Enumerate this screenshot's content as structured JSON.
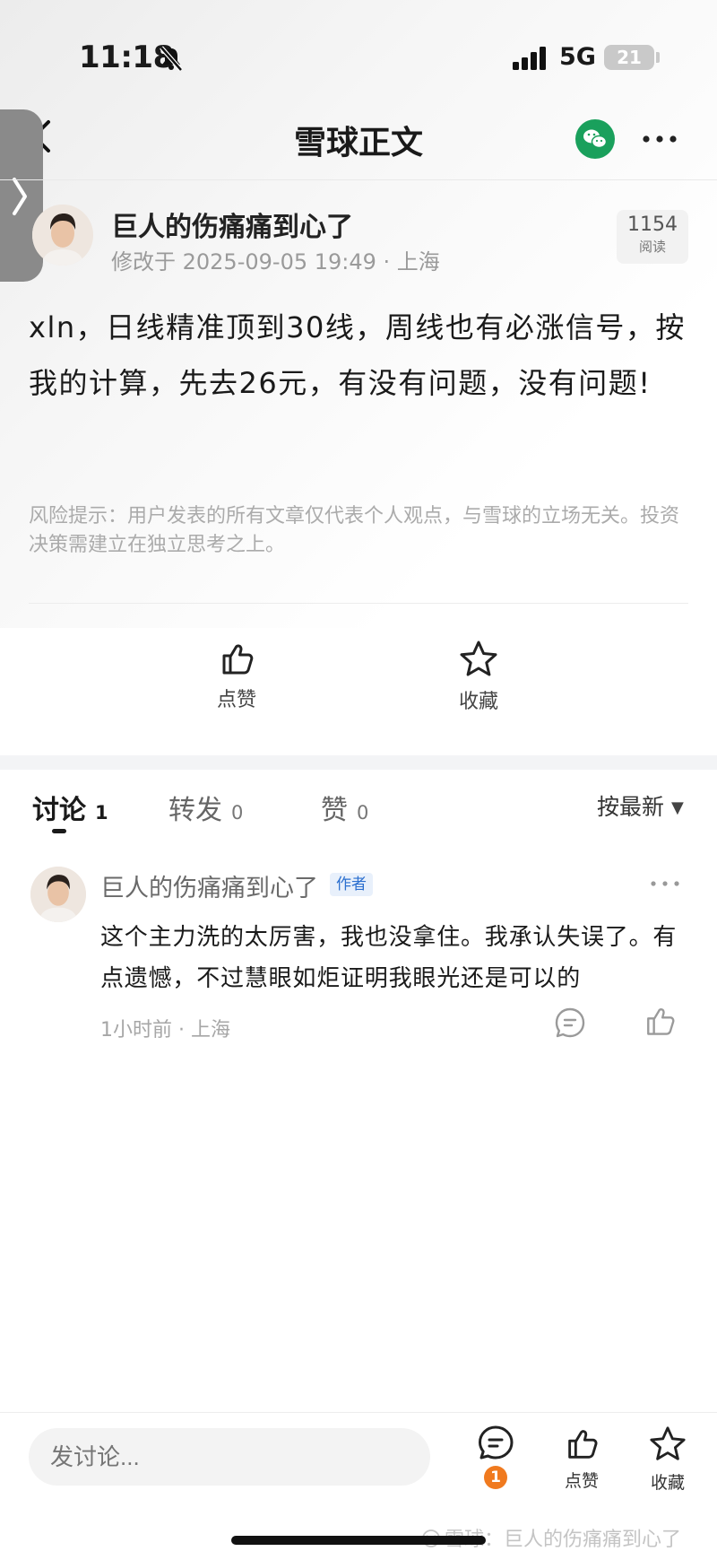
{
  "status_bar": {
    "time": "11:18",
    "network": "5G",
    "battery": "21"
  },
  "nav": {
    "title": "雪球正文"
  },
  "post": {
    "author": "巨人的伤痛痛到心了",
    "meta": "修改于 2025-09-05 19:49 · 上海",
    "read_count": "1154",
    "read_label": "阅读",
    "body": "xln，日线精准顶到30线，周线也有必涨信号，按我的计算，先去26元，有没有问题，没有问题!",
    "risk_notice": "风险提示：用户发表的所有文章仅代表个人观点，与雪球的立场无关。投资决策需建立在独立思考之上。",
    "like_label": "点赞",
    "favorite_label": "收藏"
  },
  "tabs": [
    {
      "label": "讨论",
      "count": "1"
    },
    {
      "label": "转发",
      "count": "0"
    },
    {
      "label": "赞",
      "count": "0"
    }
  ],
  "sort_label": "按最新",
  "comment": {
    "author": "巨人的伤痛痛到心了",
    "badge": "作者",
    "text": "这个主力洗的太厉害，我也没拿住。我承认失误了。有点遗憾，不过慧眼如炬证明我眼光还是可以的",
    "meta": "1小时前 · 上海"
  },
  "bottom_bar": {
    "input_placeholder": "发讨论...",
    "comment_badge": "1",
    "like_label": "点赞",
    "favorite_label": "收藏"
  },
  "watermark": "雪球：巨人的伤痛痛到心了",
  "colors": {
    "accent_green": "#1aa05c",
    "badge_orange": "#f07a1f",
    "author_badge_blue": "#2b6fcf"
  }
}
